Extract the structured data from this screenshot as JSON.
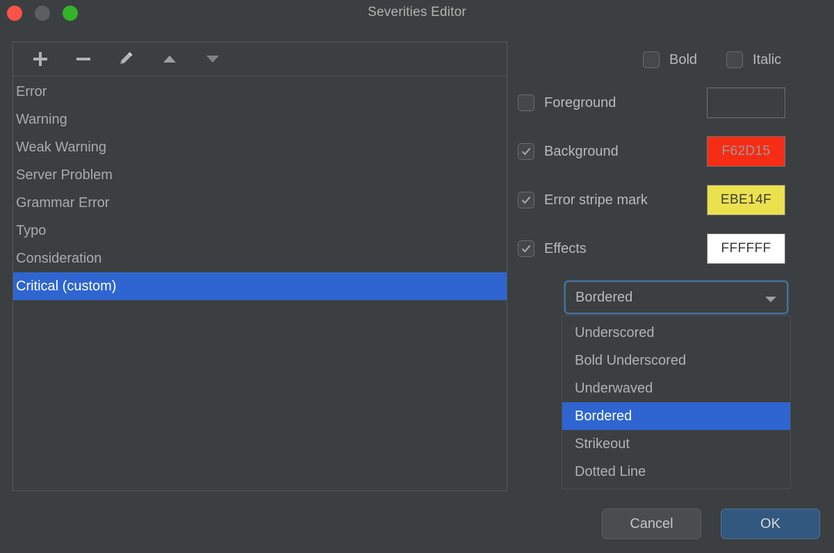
{
  "window": {
    "title": "Severities Editor",
    "controls": [
      {
        "name": "close",
        "color": "#f9524b"
      },
      {
        "name": "minimize",
        "color": "#5c5f61"
      },
      {
        "name": "maximize",
        "color": "#34b32a"
      }
    ]
  },
  "toolbar": {
    "buttons": [
      {
        "name": "add-icon",
        "label": "+"
      },
      {
        "name": "remove-icon",
        "label": "−"
      },
      {
        "name": "edit-icon",
        "label": "pencil"
      },
      {
        "name": "move-up-icon",
        "label": "▲"
      },
      {
        "name": "move-down-icon",
        "label": "▼"
      }
    ]
  },
  "severity_list": {
    "items": [
      {
        "label": "Error",
        "selected": false
      },
      {
        "label": "Warning",
        "selected": false
      },
      {
        "label": "Weak Warning",
        "selected": false
      },
      {
        "label": "Server Problem",
        "selected": false
      },
      {
        "label": "Grammar Error",
        "selected": false
      },
      {
        "label": "Typo",
        "selected": false
      },
      {
        "label": "Consideration",
        "selected": false
      },
      {
        "label": "Critical (custom)",
        "selected": true
      }
    ]
  },
  "font_options": {
    "bold": {
      "label": "Bold",
      "checked": false
    },
    "italic": {
      "label": "Italic",
      "checked": false
    }
  },
  "color_properties": [
    {
      "label": "Foreground",
      "checked": false,
      "value": "",
      "swatch_class": "empty"
    },
    {
      "label": "Background",
      "checked": true,
      "value": "F62D15",
      "swatch_class": "red"
    },
    {
      "label": "Error stripe mark",
      "checked": true,
      "value": "EBE14F",
      "swatch_class": "yellow"
    },
    {
      "label": "Effects",
      "checked": true,
      "value": "FFFFFF",
      "swatch_class": "white"
    }
  ],
  "effect_select": {
    "value": "Bordered",
    "expanded": true,
    "options": [
      {
        "label": "Underscored",
        "selected": false
      },
      {
        "label": "Bold Underscored",
        "selected": false
      },
      {
        "label": "Underwaved",
        "selected": false
      },
      {
        "label": "Bordered",
        "selected": true
      },
      {
        "label": "Strikeout",
        "selected": false
      },
      {
        "label": "Dotted Line",
        "selected": false
      }
    ]
  },
  "actions": {
    "cancel_label": "Cancel",
    "ok_label": "OK"
  },
  "colors": {
    "selection_blue": "#2f65d0",
    "background_swatch": "#F62D15",
    "stripe_swatch": "#EBE14F",
    "effects_swatch": "#FFFFFF",
    "window_bg": "#3c3f41"
  }
}
